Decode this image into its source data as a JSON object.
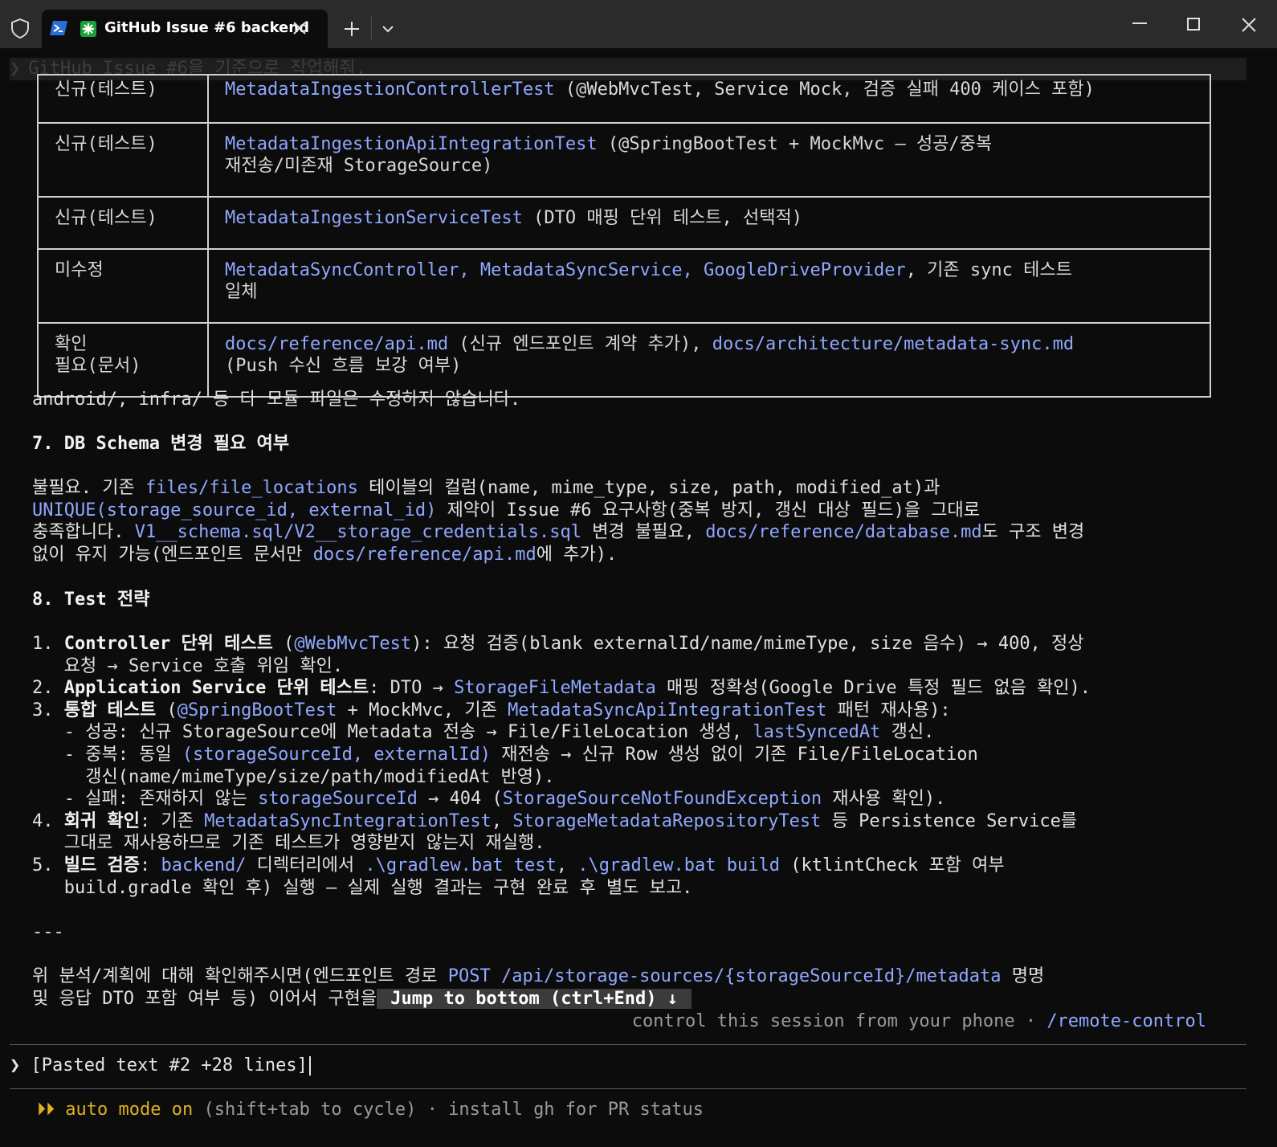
{
  "window": {
    "tab_title": "GitHub Issue #6 backend",
    "icons": [
      "shield-icon",
      "powershell-icon",
      "asterisk-icon",
      "close-icon",
      "plus-icon",
      "chevron-down-icon",
      "minimize-icon",
      "maximize-icon",
      "close-window-icon"
    ]
  },
  "ghost_prompt": "GitHub Issue #6을 기준으로 작업해줘.",
  "files_table": [
    {
      "kind": "신규(테스트)",
      "desc_code": "MetadataIngestionControllerTest",
      "desc_text": " (@WebMvcTest, Service Mock, 검증 실패 400 케이스 포함)"
    },
    {
      "kind": "신규(테스트)",
      "desc_code": "MetadataIngestionApiIntegrationTest",
      "desc_text": " (@SpringBootTest + MockMvc — 성공/중복\n재전송/미존재 StorageSource)"
    },
    {
      "kind": "신규(테스트)",
      "desc_code": "MetadataIngestionServiceTest",
      "desc_text": " (DTO 매핑 단위 테스트, 선택적)"
    },
    {
      "kind": "미수정",
      "desc_code": "MetadataSyncController, MetadataSyncService, GoogleDriveProvider",
      "desc_text": ", 기존 sync 테스트\n일체"
    },
    {
      "kind": "확인\n필요(문서)",
      "desc_code": "docs/reference/api.md",
      "desc_text": " (신규 엔드포인트 계약 추가), ",
      "desc_code2": "docs/architecture/metadata-sync.md",
      "desc_text2": "\n(Push 수신 흐름 보강 여부)"
    }
  ],
  "note_line": "android/, infra/ 등 타 모듈 파일은 수정하지 않습니다.",
  "section7": {
    "heading": "7. DB Schema 변경 필요 여부",
    "p1": "불필요. 기존 ",
    "c1": "files/file_locations",
    "p2": " 테이블의 컬럼(name, mime_type, size, path, modified_at)과",
    "c2": "UNIQUE(storage_source_id, external_id)",
    "p3": " 제약이 Issue #6 요구사항(중복 방지, 갱신 대상 필드)을 그대로",
    "p4": "충족합니다. ",
    "c3": "V1__schema.sql/V2__storage_credentials.sql",
    "p5": " 변경 불필요, ",
    "c4": "docs/reference/database.md",
    "p6": "도 구조 변경",
    "p7": "없이 유지 가능(엔드포인트 문서만 ",
    "c5": "docs/reference/api.md",
    "p8": "에 추가)."
  },
  "section8": {
    "heading": "8. Test 전략",
    "l1a": "1. ",
    "l1b": "Controller 단위 테스트",
    "l1c": " (",
    "l1d": "@WebMvcTest",
    "l1e": "): 요청 검증(blank externalId/name/mimeType, size 음수) → 400, 정상",
    "l1f": "   요청 → Service 호출 위임 확인.",
    "l2a": "2. ",
    "l2b": "Application Service 단위 테스트",
    "l2c": ": DTO → ",
    "l2d": "StorageFileMetadata",
    "l2e": " 매핑 정확성(Google Drive 특정 필드 없음 확인).",
    "l3a": "3. ",
    "l3b": "통합 테스트",
    "l3c": " (",
    "l3d": "@SpringBootTest",
    "l3e": " + MockMvc, 기존 ",
    "l3f": "MetadataSyncApiIntegrationTest",
    "l3g": " 패턴 재사용):",
    "l3h": "   - 성공: 신규 StorageSource에 Metadata 전송 → File/FileLocation 생성, ",
    "l3i": "lastSyncedAt",
    "l3j": " 갱신.",
    "l3k": "   - 중복: 동일 ",
    "l3l": "(storageSourceId, externalId)",
    "l3m": " 재전송 → 신규 Row 생성 없이 기존 File/FileLocation",
    "l3n": "     갱신(name/mimeType/size/path/modifiedAt 반영).",
    "l3o": "   - 실패: 존재하지 않는 ",
    "l3p": "storageSourceId",
    "l3q": " → 404 (",
    "l3r": "StorageSourceNotFoundException",
    "l3s": " 재사용 확인).",
    "l4a": "4. ",
    "l4b": "회귀 확인",
    "l4c": ": 기존 ",
    "l4d": "MetadataSyncIntegrationTest",
    "l4e": ", ",
    "l4f": "StorageMetadataRepositoryTest",
    "l4g": " 등 Persistence Service를",
    "l4h": "   그대로 재사용하므로 기존 테스트가 영향받지 않는지 재실행.",
    "l5a": "5. ",
    "l5b": "빌드 검증",
    "l5c": ": ",
    "l5d": "backend/",
    "l5e": " 디렉터리에서 ",
    "l5f": ".\\gradlew.bat test",
    "l5g": ", ",
    "l5h": ".\\gradlew.bat build",
    "l5i": " (ktlintCheck 포함 여부",
    "l5j": "   build.gradle 확인 후) 실행 — 실제 실행 결과는 구현 완료 후 별도 보고."
  },
  "hr": "---",
  "closing": {
    "t1": "위 분석/계획에 대해 확인해주시면(엔드포인트 경로 ",
    "c1": "POST /api/storage-sources/{storageSourceId}/metadata",
    "t2": " 명명",
    "t3": "및 응답 DTO 포함 여부 등) 이어서 구현을",
    "jump": " Jump to bottom (ctrl+End) ↓ "
  },
  "hint": {
    "text": "control this session from your phone · ",
    "cmd": "/remote-control"
  },
  "input": {
    "chevron": "❯",
    "value": "[Pasted text #2 +28 lines]"
  },
  "status": {
    "arrows": "⏵⏵",
    "mode": "auto mode on",
    "rest": " (shift+tab to cycle) · install gh for PR status"
  }
}
